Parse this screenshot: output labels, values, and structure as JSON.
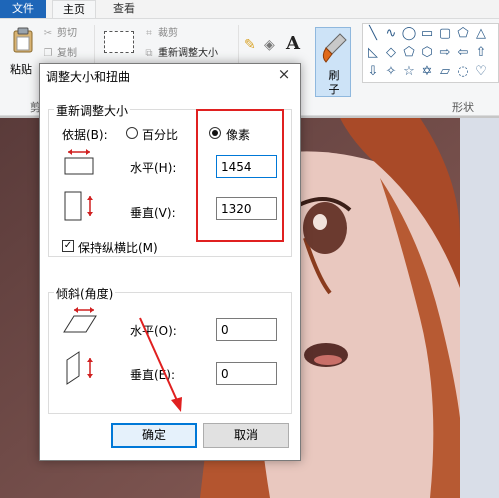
{
  "ribbon": {
    "tabs": [
      {
        "label": "文件"
      },
      {
        "label": "主页"
      },
      {
        "label": "查看"
      }
    ],
    "clipboard": {
      "paste_label": "粘贴",
      "cut_label": "剪切",
      "copy_label": "复制",
      "group_label": "剪"
    },
    "image": {
      "crop_label": "裁剪",
      "resize_label": "重新调整大小"
    },
    "brush_label_top": "刷",
    "brush_label_bottom": "子",
    "shapes_group_label": "形状"
  },
  "dialog": {
    "title": "调整大小和扭曲",
    "close_glyph": "×",
    "resize": {
      "group_title": "重新调整大小",
      "by_label": "依据(B):",
      "percent_label": "百分比",
      "pixels_label": "像素",
      "selected": "pixels",
      "horizontal_label": "水平(H):",
      "horizontal_value": "1454",
      "vertical_label": "垂直(V):",
      "vertical_value": "1320",
      "keep_ratio_label": "保持纵横比(M)",
      "keep_ratio_checked": true
    },
    "skew": {
      "group_title": "倾斜(角度)",
      "horizontal_label": "水平(O):",
      "horizontal_value": "0",
      "vertical_label": "垂直(E):",
      "vertical_value": "0"
    },
    "ok_label": "确定",
    "cancel_label": "取消"
  },
  "annotation_color": "#e02020",
  "accent_color": "#0078d7"
}
